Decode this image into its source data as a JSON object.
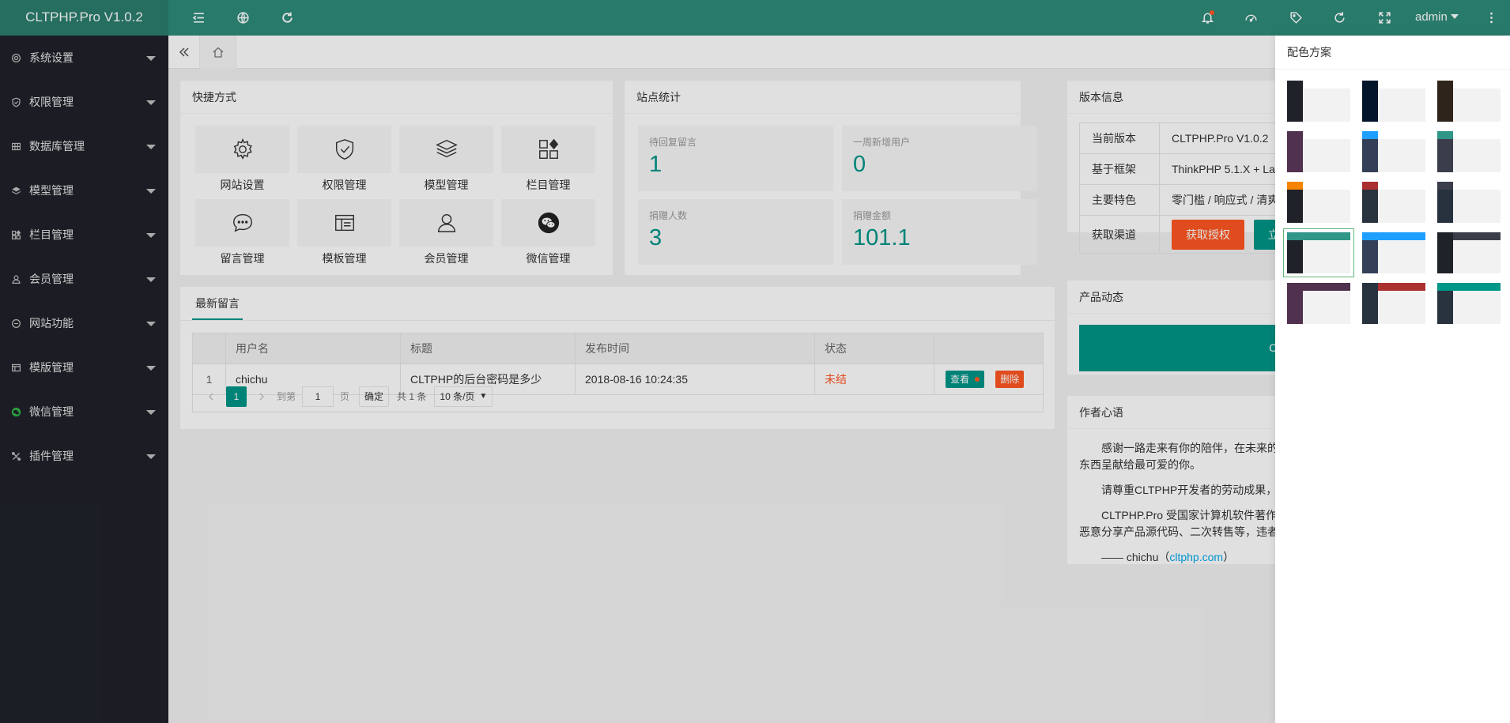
{
  "app": {
    "title": "CLTPHP.Pro V1.0.2"
  },
  "header": {
    "user": "admin",
    "left_icons": [
      "menu-indent-icon",
      "globe-icon",
      "refresh-icon"
    ],
    "right_icons": [
      "bell-icon",
      "dashboard-icon",
      "tag-icon",
      "refresh-icon",
      "fullscreen-icon",
      "more-vertical-icon"
    ]
  },
  "sidebar": {
    "items": [
      {
        "label": "系统设置",
        "icon": "gear-icon"
      },
      {
        "label": "权限管理",
        "icon": "shield-icon"
      },
      {
        "label": "数据库管理",
        "icon": "grid-icon"
      },
      {
        "label": "模型管理",
        "icon": "layers-icon"
      },
      {
        "label": "栏目管理",
        "icon": "apps-icon"
      },
      {
        "label": "会员管理",
        "icon": "user-icon"
      },
      {
        "label": "网站功能",
        "icon": "globe-icon"
      },
      {
        "label": "模版管理",
        "icon": "template-icon"
      },
      {
        "label": "微信管理",
        "icon": "wechat-icon"
      },
      {
        "label": "插件管理",
        "icon": "plugin-icon"
      }
    ]
  },
  "shortcuts": {
    "title": "快捷方式",
    "items": [
      {
        "label": "网站设置",
        "icon": "gear-icon"
      },
      {
        "label": "权限管理",
        "icon": "shield-icon"
      },
      {
        "label": "模型管理",
        "icon": "layers-icon"
      },
      {
        "label": "栏目管理",
        "icon": "apps-icon"
      },
      {
        "label": "留言管理",
        "icon": "chat-icon"
      },
      {
        "label": "模板管理",
        "icon": "template-icon"
      },
      {
        "label": "会员管理",
        "icon": "user-icon"
      },
      {
        "label": "微信管理",
        "icon": "wechat-icon"
      }
    ]
  },
  "stats": {
    "title": "站点统计",
    "items": [
      {
        "label": "待回复留言",
        "value": "1"
      },
      {
        "label": "一周新增用户",
        "value": "0"
      },
      {
        "label": "捐赠人数",
        "value": "3"
      },
      {
        "label": "捐赠金额",
        "value": "101.1"
      }
    ]
  },
  "version": {
    "title": "版本信息",
    "rows": [
      {
        "label": "当前版本",
        "value": "CLTPHP.Pro V1.0.2"
      },
      {
        "label": "基于框架",
        "value": "ThinkPHP 5.1.X + La"
      },
      {
        "label": "主要特色",
        "value": "零门槛 / 响应式 / 清爽"
      },
      {
        "label": "获取渠道",
        "value": ""
      }
    ],
    "buy_button": "获取授权",
    "other_button": "立"
  },
  "messages": {
    "tab": "最新留言",
    "columns": [
      "",
      "用户名",
      "标题",
      "发布时间",
      "状态",
      ""
    ],
    "rows": [
      {
        "num": "1",
        "user": "chichu",
        "title": "CLTPHP的后台密码是多少",
        "time": "2018-08-16 10:24:35",
        "status": "未结",
        "view": "查看",
        "delete": "删除"
      }
    ],
    "pager": {
      "page": "1",
      "goto_label": "到第",
      "goto_value": "1",
      "page_unit": "页",
      "confirm": "确定",
      "total": "共 1 条",
      "per_page": "10 条/页"
    }
  },
  "product": {
    "title": "产品动态",
    "banner_text": "CLTP"
  },
  "author": {
    "title": "作者心语",
    "p1": "感谢一路走来有你的陪伴，在未来的",
    "p1b": "东西呈献给最可爱的你。",
    "p2": "请尊重CLTPHP开发者的劳动成果，",
    "p3": "CLTPHP.Pro 受国家计算机软件著作",
    "p3b": "恶意分享产品源代码、二次转售等，违者",
    "sign_prefix": "—— chichu（",
    "sign_link": "cltphp.com",
    "sign_suffix": "）"
  },
  "theme": {
    "title": "配色方案",
    "active_index": 9,
    "schemes": [
      {
        "logo": "#20222a",
        "top": "#ffffff",
        "side": "#20222a"
      },
      {
        "logo": "#03152a",
        "top": "#ffffff",
        "side": "#03152a"
      },
      {
        "logo": "#2e241b",
        "top": "#ffffff",
        "side": "#2e241b"
      },
      {
        "logo": "#50314f",
        "top": "#ffffff",
        "side": "#50314f"
      },
      {
        "logo": "#1e9fff",
        "top": "#ffffff",
        "side": "#344058"
      },
      {
        "logo": "#2f9688",
        "top": "#ffffff",
        "side": "#3b3e4a"
      },
      {
        "logo": "#f78400",
        "top": "#ffffff",
        "side": "#20222a"
      },
      {
        "logo": "#aa3130",
        "top": "#ffffff",
        "side": "#28333e"
      },
      {
        "logo": "#3b3e4a",
        "top": "#ffffff",
        "side": "#28313e"
      },
      {
        "logo": "#2f9688",
        "top": "#2f9688",
        "side": "#20222a"
      },
      {
        "logo": "#1e9fff",
        "top": "#1e9fff",
        "side": "#344058"
      },
      {
        "logo": "#20222a",
        "top": "#3b3e4a",
        "side": "#20222a"
      },
      {
        "logo": "#50314f",
        "top": "#50314f",
        "side": "#50314f"
      },
      {
        "logo": "#28333e",
        "top": "#aa3130",
        "side": "#28333e"
      },
      {
        "logo": "#009688",
        "top": "#009688",
        "side": "#28333e"
      }
    ]
  },
  "colors": {
    "primary": "#009688",
    "header": "#2e8b7a",
    "sidebar": "#20222a",
    "danger": "#ff5722"
  }
}
